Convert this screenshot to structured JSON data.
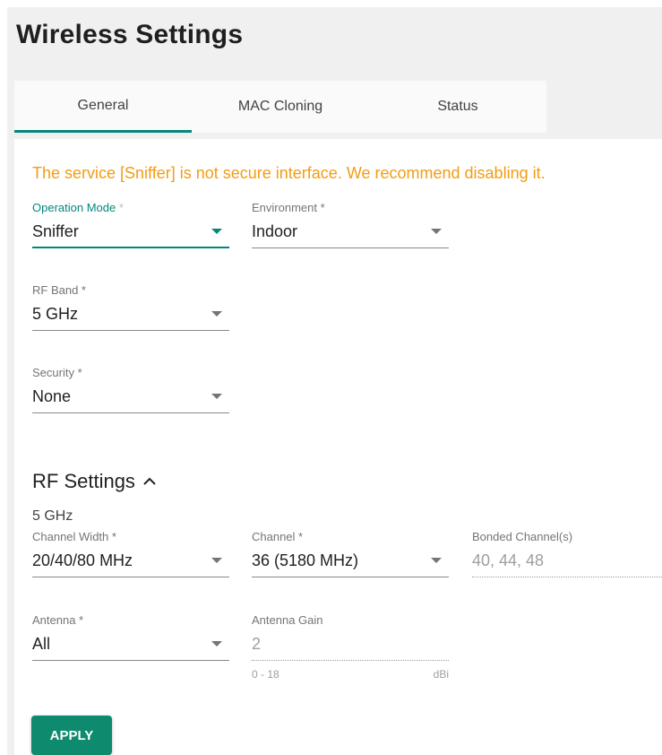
{
  "page": {
    "title": "Wireless Settings"
  },
  "tabs": [
    {
      "label": "General",
      "active": true
    },
    {
      "label": "MAC Cloning",
      "active": false
    },
    {
      "label": "Status",
      "active": false
    }
  ],
  "warning": "The service [Sniffer] is not secure interface. We recommend disabling it.",
  "fields": {
    "operation_mode": {
      "label": "Operation Mode",
      "required": "*",
      "value": "Sniffer"
    },
    "environment": {
      "label": "Environment *",
      "value": "Indoor"
    },
    "rf_band": {
      "label": "RF Band *",
      "value": "5 GHz"
    },
    "security": {
      "label": "Security *",
      "value": "None"
    }
  },
  "rf_settings": {
    "title": "RF Settings",
    "band_title": "5 GHz",
    "channel_width": {
      "label": "Channel Width *",
      "value": "20/40/80 MHz"
    },
    "channel": {
      "label": "Channel *",
      "value": "36 (5180 MHz)"
    },
    "bonded_channels": {
      "label": "Bonded Channel(s)",
      "value": "40, 44, 48"
    },
    "antenna": {
      "label": "Antenna *",
      "value": "All"
    },
    "antenna_gain": {
      "label": "Antenna Gain",
      "value": "2",
      "range": "0 - 18",
      "unit": "dBi"
    }
  },
  "actions": {
    "apply_label": "APPLY"
  },
  "colors": {
    "accent": "#00897b",
    "warning": "#f39c12",
    "button": "#0e8a6e"
  }
}
